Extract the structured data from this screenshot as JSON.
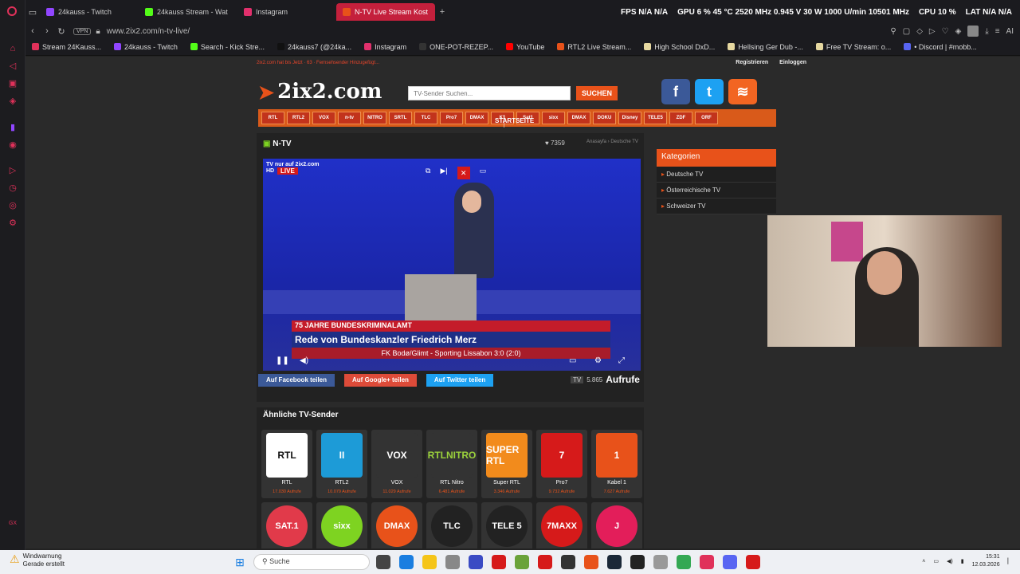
{
  "tabs": [
    {
      "label": "24kauss - Twitch",
      "color": "#9146ff"
    },
    {
      "label": "24kauss Stream - Wat",
      "color": "#53fc18"
    },
    {
      "label": "Instagram",
      "color": "#e1306c"
    },
    {
      "label": "N-TV Live Stream Kost",
      "color": "#e8521a",
      "active": true
    }
  ],
  "sysinfo": {
    "fps_label": "FPS",
    "fps_val": "N/A N/A",
    "gpu_label": "GPU",
    "gpu_val": "6 % 45 °C 2520 MHz 0.945 V 30 W 1000 U/min 10501 MHz",
    "cpu_label": "CPU",
    "cpu_val": "10 %",
    "lat_label": "LAT",
    "lat_val": "N/A N/A"
  },
  "address": {
    "vpn": "VPN",
    "url": "www.2ix2.com/n-tv-live/",
    "ai": "AI"
  },
  "bookmarks": [
    {
      "label": "Stream 24Kauss...",
      "color": "#e0315a"
    },
    {
      "label": "24kauss - Twitch",
      "color": "#9146ff"
    },
    {
      "label": "Search - Kick Stre...",
      "color": "#53fc18"
    },
    {
      "label": "24kauss7 (@24ka...",
      "color": "#111"
    },
    {
      "label": "Instagram",
      "color": "#e1306c"
    },
    {
      "label": "ONE-POT-REZEP...",
      "color": "#333"
    },
    {
      "label": "YouTube",
      "color": "#f00"
    },
    {
      "label": "RTL2 Live Stream...",
      "color": "#e8521a"
    },
    {
      "label": "High School DxD...",
      "color": "#e6d8a0"
    },
    {
      "label": "Hellsing Ger Dub -...",
      "color": "#e6d8a0"
    },
    {
      "label": "Free TV Stream: o...",
      "color": "#e6d8a0"
    },
    {
      "label": "• Discord | #mobb...",
      "color": "#5865f2"
    }
  ],
  "site": {
    "topline": "2ix2.com hat bis Jetzt · 63 · Fernsehsender Hinzugefügt...",
    "register": "Registrieren",
    "login": "Einloggen",
    "logo": "2ix2.com",
    "search_placeholder": "TV-Sender Suchen...",
    "search_btn": "SUCHEN",
    "start": "STARTSEITE",
    "channels": [
      "RTL",
      "RTL2",
      "VOX",
      "n-tv",
      "NITRO",
      "SRTL",
      "TLC",
      "Pro7",
      "DMAX",
      "K1",
      "Sat1",
      "sixx",
      "DMAX",
      "DOKU",
      "Disney",
      "TELE5",
      "ZDF",
      "ORF"
    ]
  },
  "player": {
    "channel_title": "N-TV",
    "likes": "7359",
    "crumbs": "Anasayfa › Deutsche TV",
    "live_top": "TV nur auf 2ix2.com",
    "hd": "HD",
    "live": "LIVE",
    "lower1": "75 JAHRE BUNDESKRIMINALAMT",
    "lower2": "Rede von Bundeskanzler Friedrich Merz",
    "ticker": "FK Bodø/Glimt - Sporting Lissabon 3:0 (2:0)"
  },
  "share": {
    "fb": "Auf Facebook teilen",
    "gp": "Auf Google+ teilen",
    "tw": "Auf Twitter teilen",
    "tv": "TV",
    "count": "5.865",
    "aufrufe": "Aufrufe"
  },
  "similar": {
    "title": "Ähnliche TV-Sender",
    "items": [
      {
        "name": "RTL",
        "views": "17.030 Aufrufe",
        "logo": "RTL",
        "bg": "#fff",
        "fg": "#111"
      },
      {
        "name": "RTL2",
        "views": "10.079 Aufrufe",
        "logo": "II",
        "bg": "#1d9bd7",
        "fg": "#fff"
      },
      {
        "name": "VOX",
        "views": "11.029 Aufrufe",
        "logo": "VOX",
        "bg": "#333",
        "fg": "#fff"
      },
      {
        "name": "RTL Nitro",
        "views": "6.481 Aufrufe",
        "logo": "RTLNITRO",
        "bg": "#333",
        "fg": "#9bd23c"
      },
      {
        "name": "Super RTL",
        "views": "3.346 Aufrufe",
        "logo": "SUPER RTL",
        "bg": "#f28b1c",
        "fg": "#fff"
      },
      {
        "name": "Pro7",
        "views": "9.732 Aufrufe",
        "logo": "7",
        "bg": "#d61a1a",
        "fg": "#fff"
      },
      {
        "name": "Kabel 1",
        "views": "7.627 Aufrufe",
        "logo": "1",
        "bg": "#e8521a",
        "fg": "#fff"
      }
    ],
    "row2": [
      {
        "logo": "SAT.1",
        "bg": "#e13a4a"
      },
      {
        "logo": "sixx",
        "bg": "#7ed321"
      },
      {
        "logo": "DMAX",
        "bg": "#e8521a"
      },
      {
        "logo": "TLC",
        "bg": "#222"
      },
      {
        "logo": "TELE 5",
        "bg": "#222"
      },
      {
        "logo": "7MAXX",
        "bg": "#d61a1a"
      },
      {
        "logo": "J",
        "bg": "#e31e5a"
      }
    ]
  },
  "categories": {
    "title": "Kategorien",
    "items": [
      "Deutsche TV",
      "Österreichische TV",
      "Schweizer TV"
    ]
  },
  "taskbar": {
    "warn_title": "Windwarnung",
    "warn_sub": "Gerade erstellt",
    "search": "Suche",
    "time": "15:31",
    "date": "12.03.2026"
  }
}
